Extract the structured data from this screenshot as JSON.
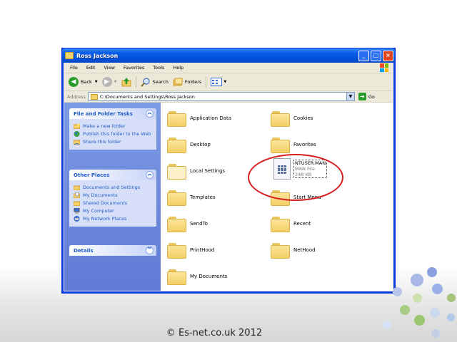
{
  "window": {
    "title": "Ross Jackson",
    "menu": [
      "File",
      "Edit",
      "View",
      "Favorites",
      "Tools",
      "Help"
    ],
    "toolbar": {
      "back": "Back",
      "search": "Search",
      "folders": "Folders"
    },
    "address": {
      "label": "Address",
      "value": "C:\\Documents and Settings\\Ross Jackson",
      "go": "Go"
    }
  },
  "sidebar": {
    "file_tasks": {
      "title": "File and Folder Tasks",
      "items": [
        "Make a new folder",
        "Publish this folder to the Web",
        "Share this folder"
      ]
    },
    "other_places": {
      "title": "Other Places",
      "items": [
        "Documents and Settings",
        "My Documents",
        "Shared Documents",
        "My Computer",
        "My Network Places"
      ]
    },
    "details": {
      "title": "Details"
    }
  },
  "folders": [
    "Application Data",
    "Cookies",
    "Desktop",
    "Favorites",
    "Local Settings",
    "Templates",
    "Start Menu",
    "SendTo",
    "Recent",
    "PrintHood",
    "NetHood",
    "My Documents"
  ],
  "file": {
    "name": "NTUSER.MAN",
    "type": "MAN File",
    "size": "248 KB"
  },
  "footer": "© Es-net.co.uk 2012",
  "colors": {
    "highlight_ring": "#d61e1e",
    "title_bar": "#0a5ee8",
    "sidebar": "#6b86dc"
  }
}
